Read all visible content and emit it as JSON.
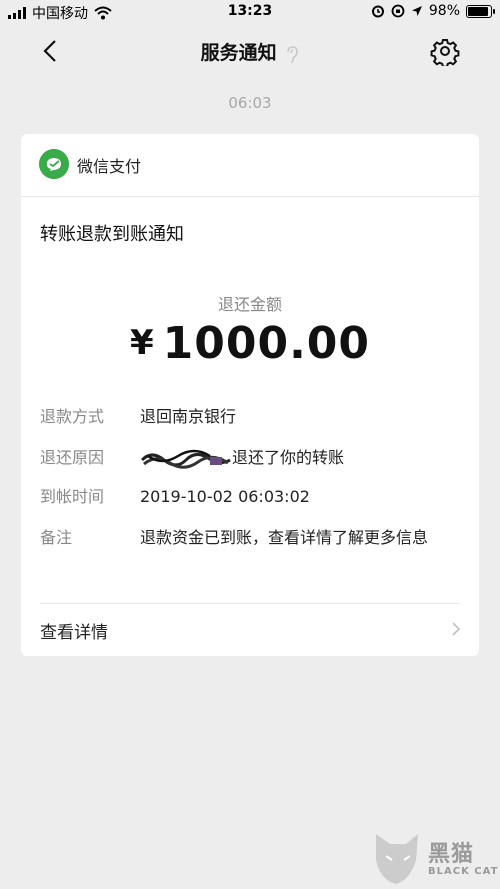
{
  "status_bar": {
    "carrier": "中国移动",
    "time": "13:23",
    "battery": "98%",
    "battery_level": 0.98,
    "icons": [
      "signal-icon",
      "wifi-icon",
      "alarm-icon",
      "orientation-lock-icon",
      "location-icon",
      "battery-icon"
    ]
  },
  "navbar": {
    "title": "服务通知",
    "icons": [
      "back-icon",
      "ear-icon",
      "settings-icon"
    ]
  },
  "message_time": "06:03",
  "card": {
    "sender": "微信支付",
    "title": "转账退款到账通知",
    "amount_label": "退还金额",
    "currency": "¥",
    "amount": "1000.00",
    "fields": [
      {
        "key": "退款方式",
        "value": "退回南京银行"
      },
      {
        "key": "退还原因",
        "value": "退还了你的转账"
      },
      {
        "key": "到帐时间",
        "value": "2019-10-02 06:03:02"
      },
      {
        "key": "备注",
        "value": "退款资金已到账，查看详情了解更多信息"
      }
    ],
    "detail_link": "查看详情"
  },
  "colors": {
    "background": "#ededed",
    "card": "#ffffff",
    "wechat_pay_green": "#3aab49",
    "label_gray": "#888888"
  },
  "watermark": {
    "main": "黑猫",
    "sub": "BLACK CAT"
  }
}
